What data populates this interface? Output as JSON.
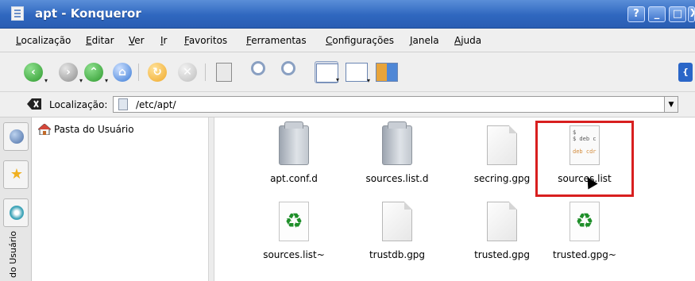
{
  "window": {
    "title": "apt - Konqueror",
    "help_label": "?",
    "minimize_label": "_",
    "maximize_label": "□",
    "close_label": "X"
  },
  "menu": {
    "items": [
      "Localização",
      "Editar",
      "Ver",
      "Ir",
      "Favoritos",
      "Ferramentas",
      "Configurações",
      "Janela",
      "Ajuda"
    ]
  },
  "toolbar": {
    "icons": [
      "back-icon",
      "forward-icon",
      "up-icon",
      "home-icon",
      "reload-icon",
      "stop-icon",
      "print-icon",
      "zoom-in-icon",
      "zoom-out-icon",
      "icon-view-icon",
      "detailed-view-icon",
      "multicolumn-view-icon",
      "konqueror-logo-icon"
    ],
    "colors": {
      "back": "#2e9a2e",
      "forward": "#8c8c8c",
      "up": "#2e9a2e",
      "home": "#3b7bd6",
      "reload": "#f0a92a",
      "stop": "#bdbdbd"
    }
  },
  "location": {
    "label": "Localização:",
    "value": "/etc/apt/"
  },
  "sidebar": {
    "tree_root": "Pasta do Usuário",
    "vertical_tab": "do Usuário"
  },
  "files": [
    {
      "name": "apt.conf.d",
      "kind": "folder"
    },
    {
      "name": "sources.list.d",
      "kind": "folder"
    },
    {
      "name": "secring.gpg",
      "kind": "page"
    },
    {
      "name": "sources.list",
      "kind": "text",
      "preview_lines": [
        "$",
        "$ deb c",
        "deb cdr"
      ]
    },
    {
      "name": "sources.list~",
      "kind": "recycle"
    },
    {
      "name": "trustdb.gpg",
      "kind": "page"
    },
    {
      "name": "trusted.gpg",
      "kind": "page"
    },
    {
      "name": "trusted.gpg~",
      "kind": "recycle"
    }
  ],
  "highlight_color": "#d81f1f"
}
